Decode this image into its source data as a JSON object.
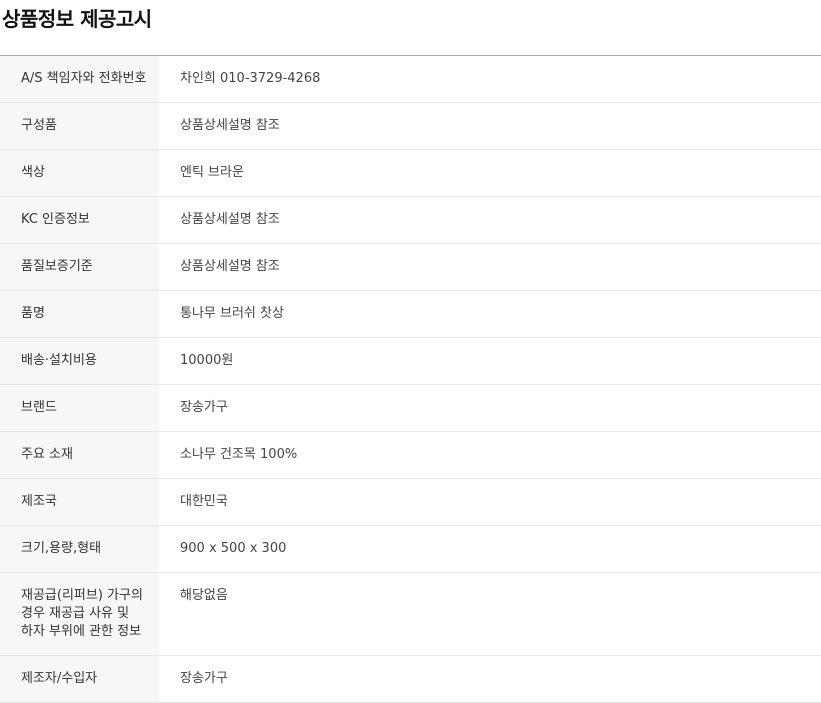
{
  "page": {
    "title": "상품정보 제공고시"
  },
  "table": {
    "rows": [
      {
        "label": "A/S 책임자와 전화번호",
        "value": "차인희 010-3729-4268"
      },
      {
        "label": "구성품",
        "value": "상품상세설명 참조"
      },
      {
        "label": "색상",
        "value": "엔틱 브라운"
      },
      {
        "label": "KC 인증정보",
        "value": "상품상세설명 참조"
      },
      {
        "label": "품질보증기준",
        "value": "상품상세설명 참조"
      },
      {
        "label": "품명",
        "value": "통나무 브러쉬 찻상"
      },
      {
        "label": "배송·설치비용",
        "value": "10000원"
      },
      {
        "label": "브랜드",
        "value": "장송가구"
      },
      {
        "label": "주요 소재",
        "value": "소나무 건조목 100%"
      },
      {
        "label": "제조국",
        "value": "대한민국"
      },
      {
        "label": "크기,용량,형태",
        "value": "900 x 500 x 300"
      },
      {
        "label": "재공급(리퍼브) 가구의 경우 재공급 사유 및 하자 부위에 관한 정보",
        "value": "해당없음"
      },
      {
        "label": "제조자/수입자",
        "value": "장송가구"
      }
    ]
  }
}
